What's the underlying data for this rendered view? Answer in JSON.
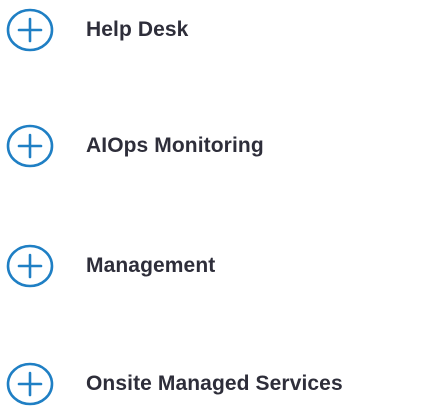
{
  "accent_color": "#1f7fc4",
  "text_color": "#2e2e3a",
  "accordion": {
    "items": [
      {
        "label": "Help Desk",
        "icon": "plus-circle-icon"
      },
      {
        "label": "AIOps Monitoring",
        "icon": "plus-circle-icon"
      },
      {
        "label": "Management",
        "icon": "plus-circle-icon"
      },
      {
        "label": "Onsite Managed Services",
        "icon": "plus-circle-icon"
      }
    ]
  }
}
